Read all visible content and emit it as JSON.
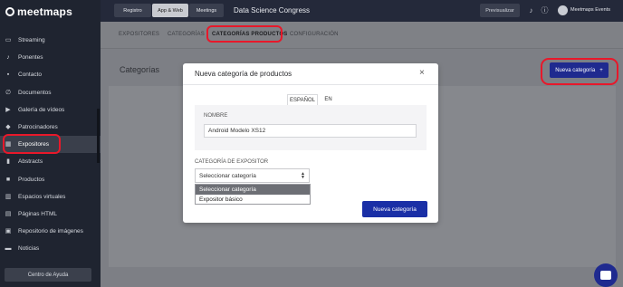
{
  "app": {
    "logo_text": "meetmaps"
  },
  "sidebar": {
    "items": [
      {
        "label": "Streaming",
        "icon": "screen-icon",
        "glyph": "▭"
      },
      {
        "label": "Ponentes",
        "icon": "microphone-icon",
        "glyph": "♪"
      },
      {
        "label": "Contacto",
        "icon": "chat-icon",
        "glyph": "▪"
      },
      {
        "label": "Documentos",
        "icon": "paperclip-icon",
        "glyph": "∅"
      },
      {
        "label": "Galería de vídeos",
        "icon": "video-icon",
        "glyph": "▶"
      },
      {
        "label": "Patrocinadores",
        "icon": "handshake-icon",
        "glyph": "◆"
      },
      {
        "label": "Expositores",
        "icon": "store-icon",
        "glyph": "▦"
      },
      {
        "label": "Abstracts",
        "icon": "bookmark-icon",
        "glyph": "▮"
      },
      {
        "label": "Productos",
        "icon": "box-icon",
        "glyph": "■"
      },
      {
        "label": "Espacios virtuales",
        "icon": "map-icon",
        "glyph": "▥"
      },
      {
        "label": "Páginas HTML",
        "icon": "columns-icon",
        "glyph": "▤"
      },
      {
        "label": "Repositorio de imágenes",
        "icon": "images-icon",
        "glyph": "▣"
      },
      {
        "label": "Noticias",
        "icon": "newspaper-icon",
        "glyph": "▬"
      }
    ],
    "active_index": 6,
    "help_label": "Centro de Ayuda"
  },
  "topbar": {
    "tabs": [
      "Registro",
      "App & Web",
      "Meetings"
    ],
    "active_tab": "App & Web",
    "event_title": "Data Science Congress",
    "preview_label": "Previsualizar",
    "user_name": "Meetmaps Events"
  },
  "subtabs": {
    "items": [
      "EXPOSITORES",
      "CATEGORÍAS",
      "CATEGORÍAS PRODUCTOS",
      "CONFIGURACIÓN"
    ],
    "active": "CATEGORÍAS PRODUCTOS"
  },
  "main": {
    "title": "Categorías",
    "new_category_label": "Nueva categoría",
    "new_category_plus": "+"
  },
  "modal": {
    "title": "Nueva categoría de productos",
    "close_glyph": "×",
    "lang_tabs": [
      "ESPAÑOL",
      "EN"
    ],
    "active_lang": "ESPAÑOL",
    "name_label": "NOMBRE",
    "name_value": "Android Modelo XS12",
    "category_label": "CATEGORÍA DE EXPOSITOR",
    "select_value": "Seleccionar categoría",
    "options": [
      "Seleccionar categoría",
      "Expositor básico"
    ],
    "highlighted_option": 0,
    "submit_label": "Nueva categoría"
  },
  "colors": {
    "sidebar_bg": "#1f2430",
    "primary_button": "#1a2fa6",
    "highlight_red": "#e8182a"
  }
}
